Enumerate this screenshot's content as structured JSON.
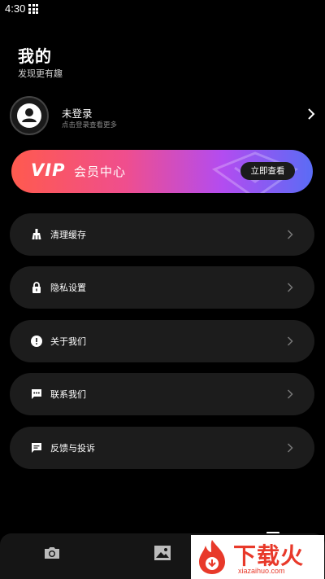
{
  "status_bar": {
    "time": "4:30"
  },
  "header": {
    "title": "我的",
    "subtitle": "发现更有趣"
  },
  "profile": {
    "name": "未登录",
    "hint": "点击登录查看更多"
  },
  "vip": {
    "logo": "VIP",
    "title": "会员中心",
    "button_label": "立即查看"
  },
  "menu": [
    {
      "label": "清理缓存",
      "icon": "broom-icon"
    },
    {
      "label": "隐私设置",
      "icon": "lock-icon"
    },
    {
      "label": "关于我们",
      "icon": "info-icon"
    },
    {
      "label": "联系我们",
      "icon": "chat-icon"
    },
    {
      "label": "反馈与投诉",
      "icon": "feedback-icon"
    }
  ],
  "bottom_nav": [
    {
      "icon": "camera-icon"
    },
    {
      "icon": "image-icon"
    },
    {
      "icon": "profile-icon",
      "active": true
    }
  ],
  "watermark": {
    "text": "下载火",
    "url": "xiazaihuo.com"
  },
  "colors": {
    "background": "#000000",
    "card": "#1c1c1c",
    "vip_start": "#ff5a4e",
    "vip_end": "#5a6cf5",
    "watermark": "#e8392a"
  }
}
